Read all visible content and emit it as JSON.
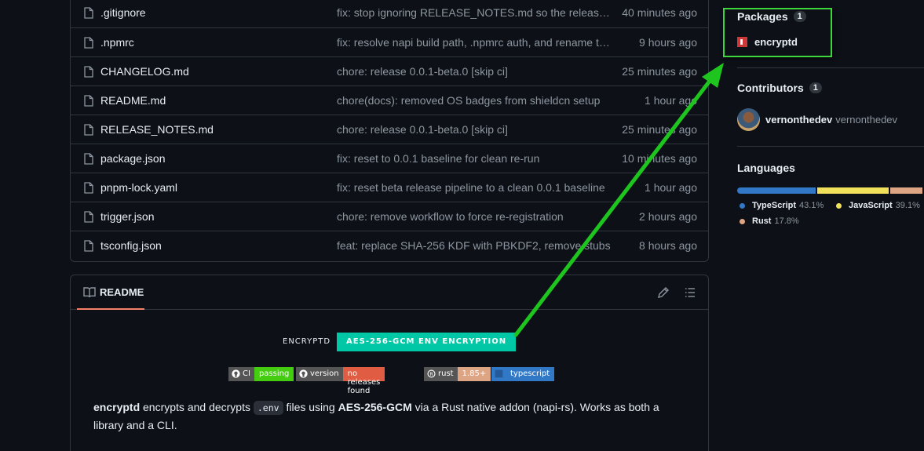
{
  "files": [
    {
      "name": ".gitignore",
      "commit": "fix: stop ignoring RELEASE_NOTES.md so the release commit …",
      "time": "40 minutes ago"
    },
    {
      "name": ".npmrc",
      "commit": "fix: resolve napi build path, .npmrc auth, and rename test file",
      "time": "9 hours ago"
    },
    {
      "name": "CHANGELOG.md",
      "commit": "chore: release 0.0.1-beta.0 [skip ci]",
      "time": "25 minutes ago"
    },
    {
      "name": "README.md",
      "commit": "chore(docs): removed OS badges from shieldcn setup",
      "time": "1 hour ago"
    },
    {
      "name": "RELEASE_NOTES.md",
      "commit": "chore: release 0.0.1-beta.0 [skip ci]",
      "time": "25 minutes ago"
    },
    {
      "name": "package.json",
      "commit": "fix: reset to 0.0.1 baseline for clean re-run",
      "time": "10 minutes ago"
    },
    {
      "name": "pnpm-lock.yaml",
      "commit": "fix: reset beta release pipeline to a clean 0.0.1 baseline",
      "time": "1 hour ago"
    },
    {
      "name": "trigger.json",
      "commit": "chore: remove workflow to force re-registration",
      "time": "2 hours ago"
    },
    {
      "name": "tsconfig.json",
      "commit": "feat: replace SHA-256 KDF with PBKDF2, remove stubs",
      "time": "8 hours ago"
    }
  ],
  "readme": {
    "tab_label": "README",
    "badge_main": {
      "left": "ENCRYPTD",
      "right": "AES-256-GCM ENV ENCRYPTION"
    },
    "badges": [
      {
        "label": "CI",
        "value": "passing",
        "color": "#4c1"
      },
      {
        "label": "version",
        "value": "no releases found",
        "color": "#e05d44"
      },
      {
        "label": "rust",
        "value": "1.85+",
        "color": "#dea584"
      },
      {
        "label": "",
        "value": "typescript",
        "color": "#3178c6"
      }
    ],
    "desc": {
      "name": "encryptd",
      "t1": " encrypts and decrypts ",
      "code": ".env",
      "t2": " files using ",
      "algo": "AES-256-GCM",
      "t3": " via a Rust native addon (napi-rs). Works as both a library and a CLI."
    }
  },
  "sidebar": {
    "packages": {
      "title": "Packages",
      "count": "1",
      "items": [
        {
          "name": "encryptd"
        }
      ]
    },
    "contributors": {
      "title": "Contributors",
      "count": "1",
      "items": [
        {
          "login": "vernonthedev",
          "name": "vernonthedev"
        }
      ]
    },
    "languages": {
      "title": "Languages",
      "items": [
        {
          "name": "TypeScript",
          "percent": "43.1%",
          "value": 43.1,
          "color": "#3178c6"
        },
        {
          "name": "JavaScript",
          "percent": "39.1%",
          "value": 39.1,
          "color": "#f1e05a"
        },
        {
          "name": "Rust",
          "percent": "17.8%",
          "value": 17.8,
          "color": "#dea584"
        }
      ]
    }
  },
  "colors": {
    "accent_tab": "#f78166",
    "highlight": "#3dd63d",
    "arrow": "#1ec51e"
  }
}
